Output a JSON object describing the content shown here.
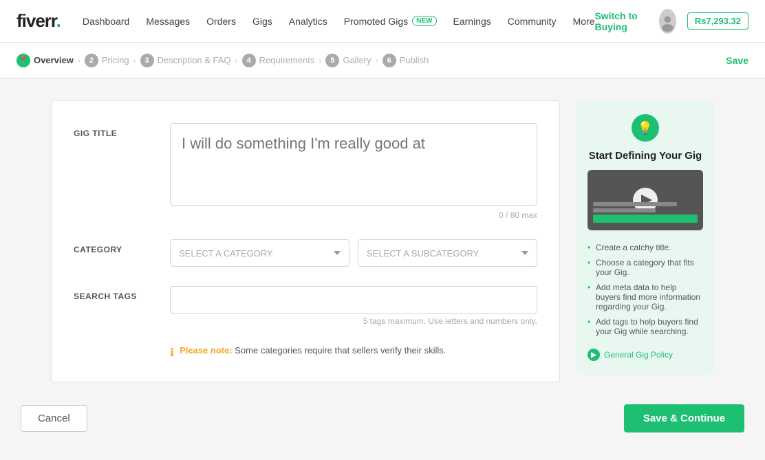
{
  "navbar": {
    "logo": "fiverr",
    "links": [
      {
        "label": "Dashboard",
        "name": "dashboard"
      },
      {
        "label": "Messages",
        "name": "messages"
      },
      {
        "label": "Orders",
        "name": "orders"
      },
      {
        "label": "Gigs",
        "name": "gigs"
      },
      {
        "label": "Analytics",
        "name": "analytics"
      },
      {
        "label": "Promoted Gigs",
        "name": "promoted-gigs"
      },
      {
        "label": "NEW",
        "name": "new-badge"
      },
      {
        "label": "Earnings",
        "name": "earnings"
      },
      {
        "label": "Community",
        "name": "community"
      },
      {
        "label": "More",
        "name": "more"
      }
    ],
    "switch_buying": "Switch to Buying",
    "balance": "Rs7,293.32"
  },
  "breadcrumb": {
    "save_label": "Save",
    "steps": [
      {
        "num": "1",
        "label": "Overview",
        "active": true,
        "icon": "location"
      },
      {
        "num": "2",
        "label": "Pricing",
        "active": false
      },
      {
        "num": "3",
        "label": "Description & FAQ",
        "active": false
      },
      {
        "num": "4",
        "label": "Requirements",
        "active": false
      },
      {
        "num": "5",
        "label": "Gallery",
        "active": false
      },
      {
        "num": "6",
        "label": "Publish",
        "active": false
      }
    ]
  },
  "form": {
    "gig_title_label": "GIG TITLE",
    "gig_title_placeholder": "I will do something I'm really good at",
    "gig_title_value": "",
    "char_count": "0 / 80 max",
    "category_label": "CATEGORY",
    "category_placeholder": "SELECT A CATEGORY",
    "subcategory_placeholder": "SELECT A SUBCATEGORY",
    "search_tags_label": "SEARCH TAGS",
    "tags_hint": "5 tags maximum. Use letters and numbers only.",
    "notice_bold": "Please note:",
    "notice_text": " Some categories require that sellers verify their skills."
  },
  "sidebar": {
    "tip_title": "Start Defining Your Gig",
    "tips": [
      "Create a catchy title.",
      "Choose a category that fits your Gig.",
      "Add meta data to help buyers find more information regarding your Gig.",
      "Add tags to help buyers find your Gig while searching."
    ],
    "policy_label": "General Gig Policy"
  },
  "buttons": {
    "cancel": "Cancel",
    "save_continue": "Save & Continue"
  }
}
